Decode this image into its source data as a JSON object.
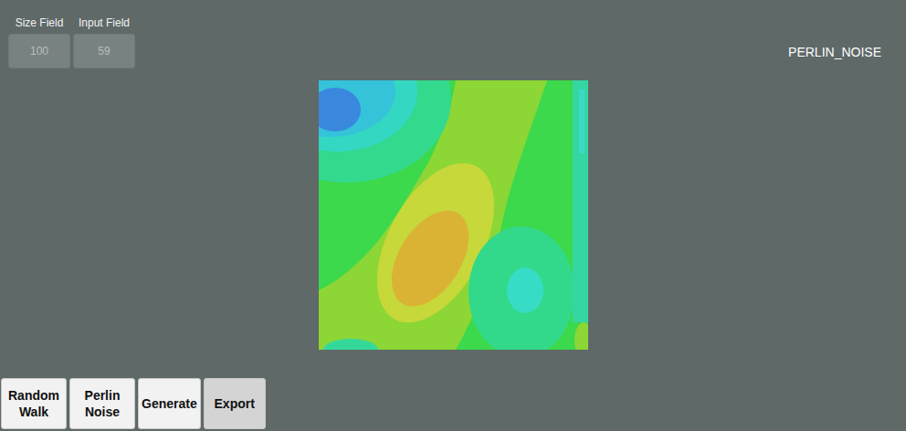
{
  "fields": [
    {
      "label": "Size Field",
      "value": "100"
    },
    {
      "label": "Input Field",
      "value": "59"
    }
  ],
  "mode_label": "PERLIN_NOISE",
  "buttons": [
    {
      "label": "Random Walk",
      "highlighted": false
    },
    {
      "label": "Perlin Noise",
      "highlighted": false
    },
    {
      "label": "Generate",
      "highlighted": false
    },
    {
      "label": "Export",
      "highlighted": true
    }
  ]
}
